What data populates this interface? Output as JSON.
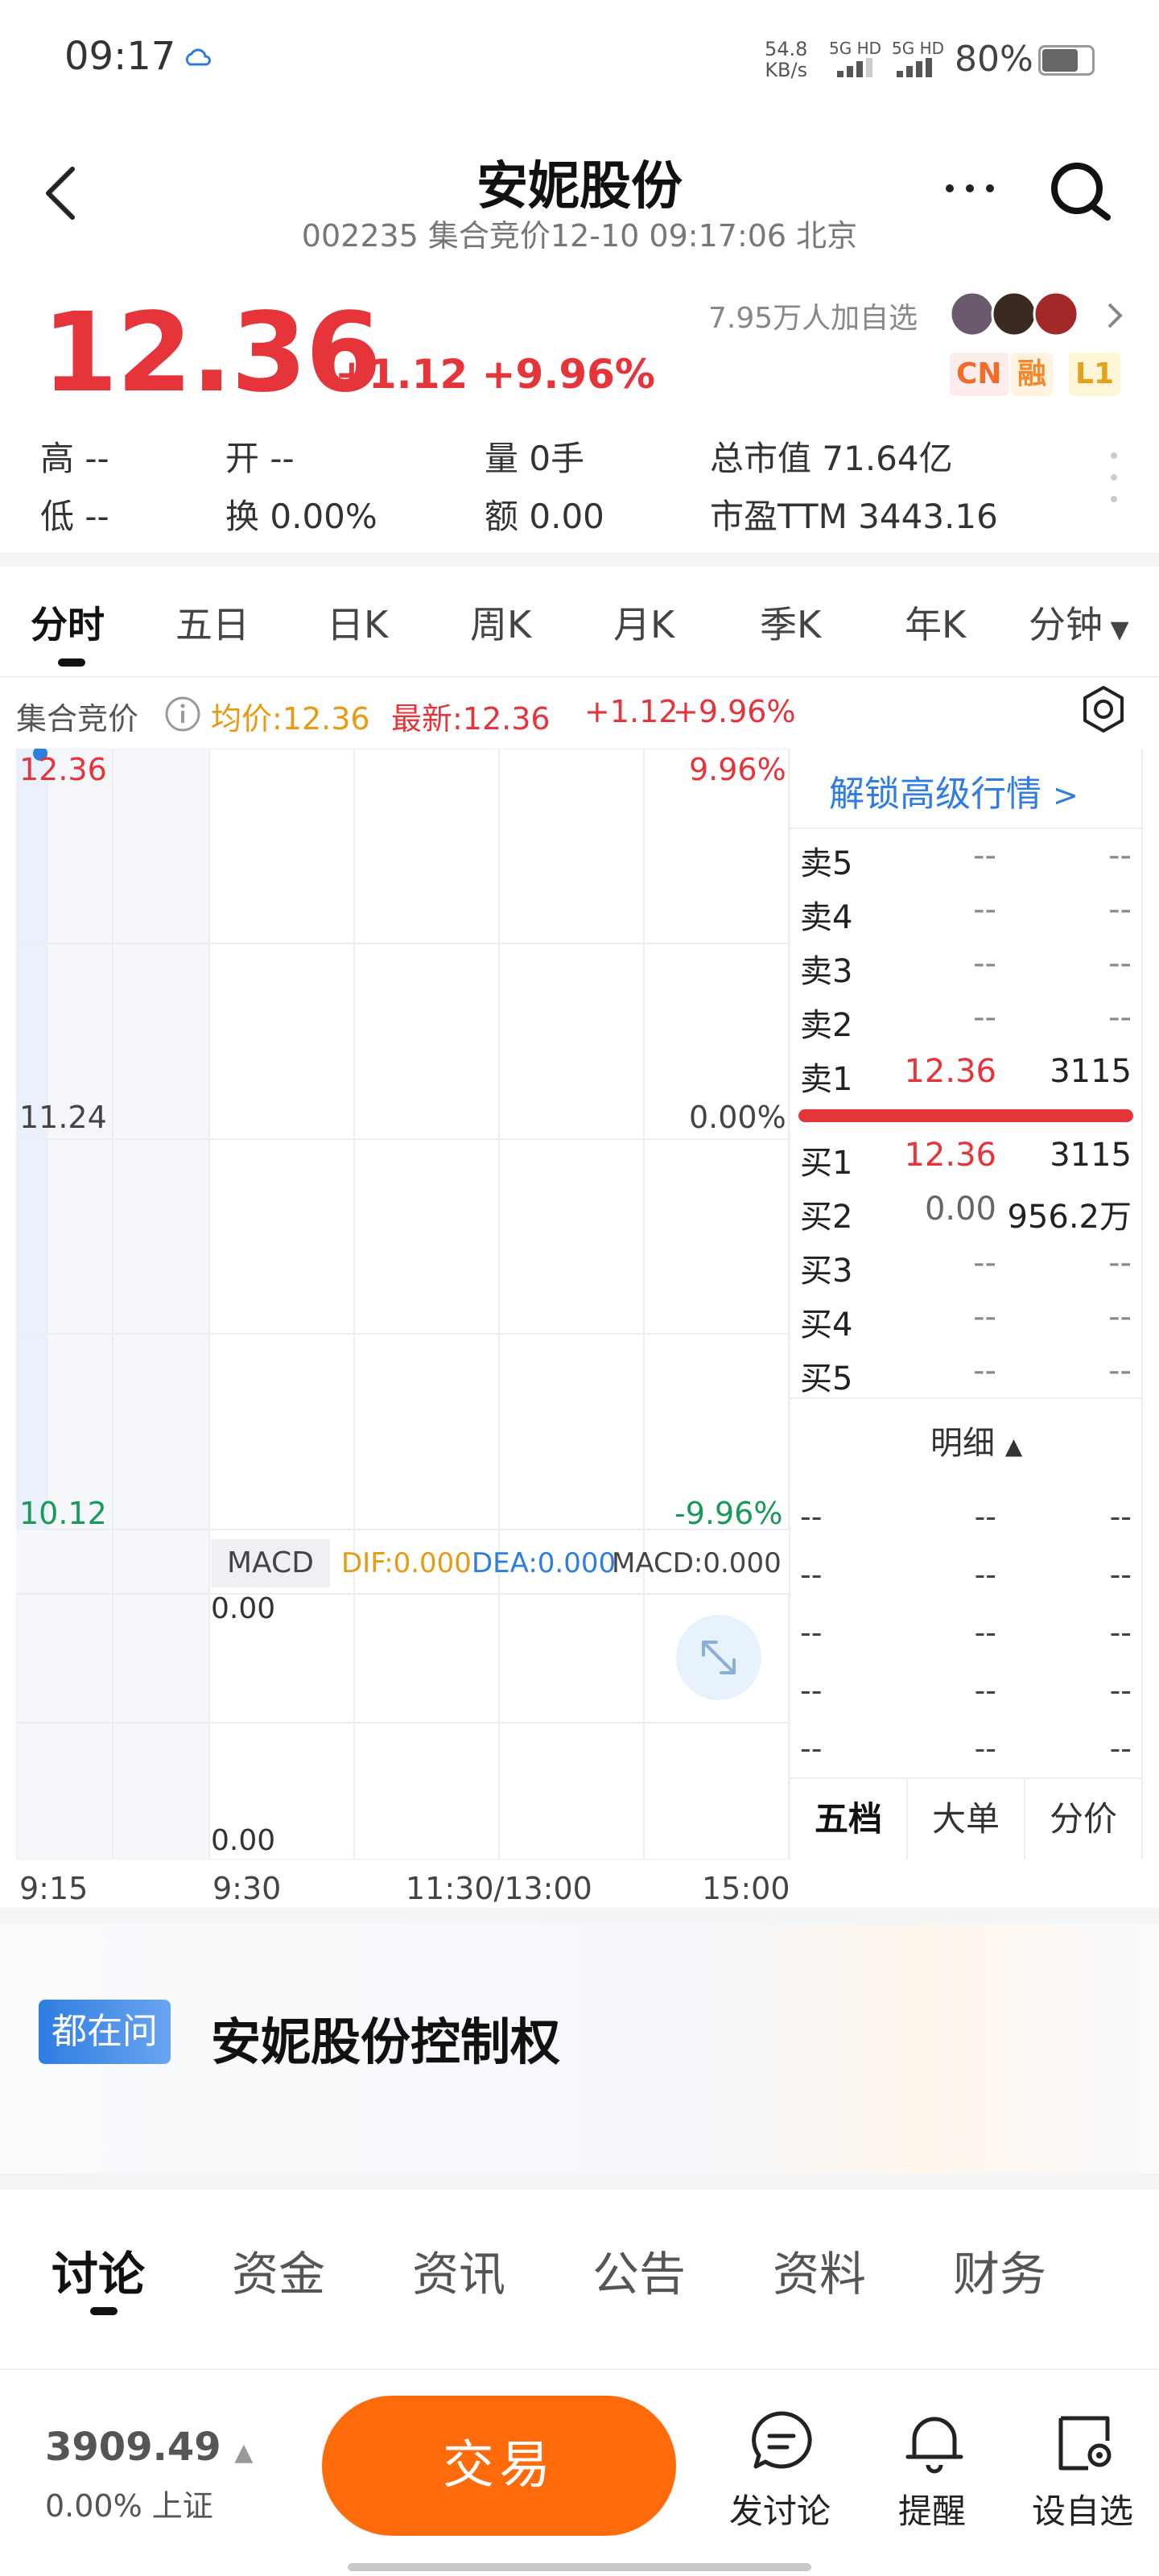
{
  "status": {
    "time": "09:17",
    "net_speed_top": "54.8",
    "net_speed_unit": "KB/s",
    "sim1": "5G HD",
    "sim2": "5G HD",
    "battery": "80%"
  },
  "header": {
    "title": "安妮股份",
    "subtitle": "002235 集合竞价12-10 09:17:06 北京"
  },
  "quote": {
    "price": "12.36",
    "change": "+1.12 +9.96%",
    "follow": "7.95万人加自选",
    "badges": [
      "CN",
      "融",
      "L1"
    ],
    "stats": [
      {
        "label": "高",
        "value": "--"
      },
      {
        "label": "开",
        "value": "--"
      },
      {
        "label": "量",
        "value": "0手"
      },
      {
        "label": "总市值",
        "value": "71.64亿"
      },
      {
        "label": "低",
        "value": "--"
      },
      {
        "label": "换",
        "value": "0.00%"
      },
      {
        "label": "额",
        "value": "0.00"
      },
      {
        "label": "市盈TTM",
        "value": "3443.16"
      }
    ]
  },
  "period_tabs": [
    "分时",
    "五日",
    "日K",
    "周K",
    "月K",
    "季K",
    "年K",
    "分钟"
  ],
  "info_line": {
    "label": "集合竞价",
    "avg": "均价:12.36",
    "latest": "最新:12.36",
    "chg": "+1.12",
    "pct": "+9.96%"
  },
  "chart_data": {
    "type": "line",
    "y_left": [
      "12.36",
      "11.24",
      "10.12"
    ],
    "y_right": [
      "9.96%",
      "0.00%",
      "-9.96%"
    ],
    "x_labels": [
      "9:15",
      "9:30",
      "11:30/13:00",
      "15:00"
    ],
    "series": [
      {
        "values": [
          12.36
        ]
      }
    ],
    "macd": {
      "label": "MACD",
      "dif": "DIF:0.000",
      "dea": "DEA:0.000",
      "macd": "MACD:0.000",
      "top": "0.00",
      "bottom": "0.00"
    }
  },
  "orderbook": {
    "unlock": "解锁高级行情",
    "sell": [
      {
        "label": "卖5",
        "price": "--",
        "vol": "--"
      },
      {
        "label": "卖4",
        "price": "--",
        "vol": "--"
      },
      {
        "label": "卖3",
        "price": "--",
        "vol": "--"
      },
      {
        "label": "卖2",
        "price": "--",
        "vol": "--"
      },
      {
        "label": "卖1",
        "price": "12.36",
        "vol": "3115"
      }
    ],
    "buy": [
      {
        "label": "买1",
        "price": "12.36",
        "vol": "3115"
      },
      {
        "label": "买2",
        "price": "0.00",
        "vol": "956.2万"
      },
      {
        "label": "买3",
        "price": "--",
        "vol": "--"
      },
      {
        "label": "买4",
        "price": "--",
        "vol": "--"
      },
      {
        "label": "买5",
        "price": "--",
        "vol": "--"
      }
    ],
    "detail_title": "明细",
    "tabs": [
      "五档",
      "大单",
      "分价"
    ]
  },
  "ask": {
    "badge": "都在问",
    "text": "安妮股份控制权"
  },
  "content_tabs": [
    "讨论",
    "资金",
    "资讯",
    "公告",
    "资料",
    "财务"
  ],
  "bottom": {
    "index_value": "3909.49",
    "index_sub": "0.00% 上证",
    "trade": "交易",
    "actions": [
      "发讨论",
      "提醒",
      "设自选"
    ]
  }
}
